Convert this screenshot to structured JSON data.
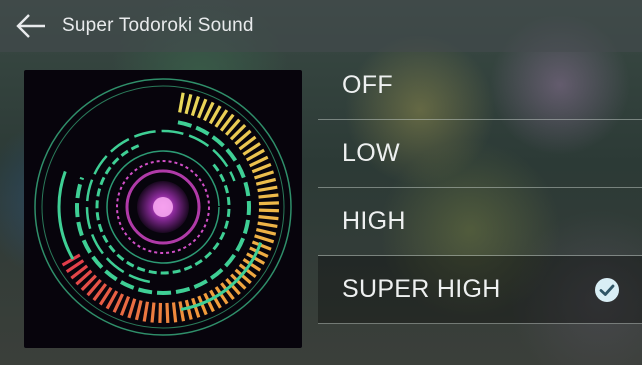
{
  "header": {
    "title": "Super Todoroki Sound",
    "back_icon": "arrow-left-icon"
  },
  "options": [
    {
      "label": "OFF",
      "selected": false
    },
    {
      "label": "LOW",
      "selected": false
    },
    {
      "label": "HIGH",
      "selected": false
    },
    {
      "label": "SUPER HIGH",
      "selected": true
    }
  ],
  "colors": {
    "accent_teal": "#3fcf95",
    "accent_magenta": "#d24fc7",
    "gradient_red": "#e23c4b",
    "gradient_orange": "#f29a3a",
    "gradient_yellow": "#e8d85a",
    "check_fill": "#d9eef5"
  }
}
